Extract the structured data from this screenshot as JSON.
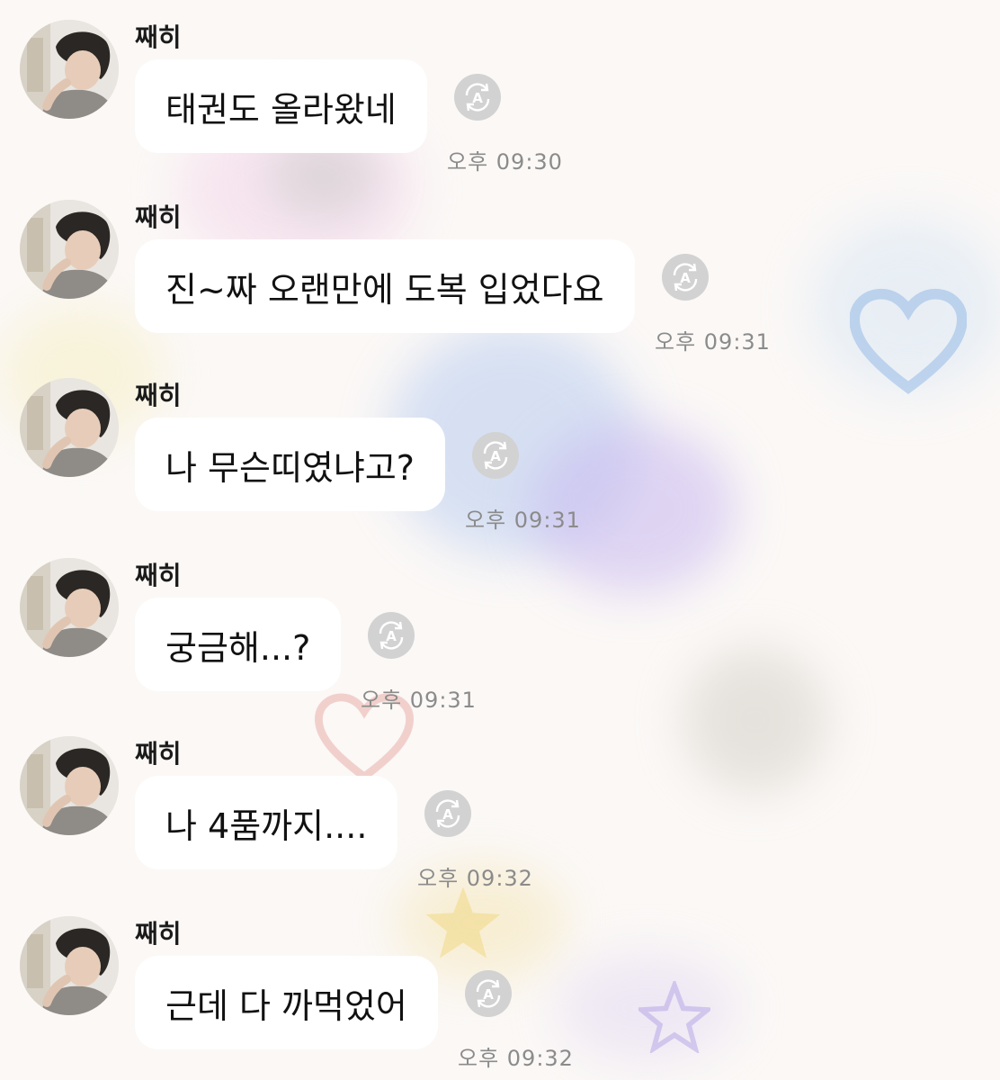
{
  "messages": [
    {
      "sender": "째히",
      "text": "태권도 올라왔네",
      "time": "오후 09:30"
    },
    {
      "sender": "째히",
      "text": "진~짜 오랜만에 도복 입었다요",
      "time": "오후 09:31"
    },
    {
      "sender": "째히",
      "text": "나 무슨띠였냐고?",
      "time": "오후 09:31"
    },
    {
      "sender": "째히",
      "text": "궁금해...?",
      "time": "오후 09:31"
    },
    {
      "sender": "째히",
      "text": "나 4품까지....",
      "time": "오후 09:32"
    },
    {
      "sender": "째히",
      "text": "근데 다 까먹었어",
      "time": "오후 09:32"
    }
  ],
  "icons": {
    "avatar": "profile-photo",
    "read_indicator": "auto-translate-icon"
  },
  "colors": {
    "bubble": "#ffffff",
    "icon_gray": "#d2d2d2",
    "time_text": "#8b8b8b"
  }
}
